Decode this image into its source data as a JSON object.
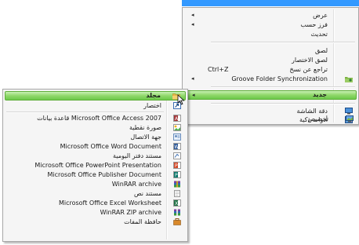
{
  "main_menu": {
    "items": [
      {
        "label": "عرض",
        "has_submenu": true
      },
      {
        "label": "فرز حسب",
        "has_submenu": true
      },
      {
        "label": "تحديث"
      },
      {
        "label": "لصق"
      },
      {
        "label": "لصق الاختصار"
      },
      {
        "label": "تراجع عن نسخ",
        "shortcut": "Ctrl+Z"
      },
      {
        "label": "Groove Folder Synchronization",
        "has_submenu": true,
        "icon": "groove-folder-icon"
      },
      {
        "label": "جديد",
        "has_submenu": true,
        "highlighted": true
      },
      {
        "label": "دقة الشاشة",
        "icon": "display-icon"
      },
      {
        "label": "أدوات ذكية",
        "icon": "gadgets-icon"
      },
      {
        "label": "تخصيص",
        "icon": "personalize-icon"
      }
    ],
    "arrow_glyph": "◂"
  },
  "new_submenu": {
    "items": [
      {
        "label": "مجلد",
        "icon": "folder-icon"
      },
      {
        "label": "اختصار",
        "icon": "shortcut-icon"
      },
      {
        "label": "Microsoft Office Access 2007 قاعدة بيانات",
        "icon": "access-icon"
      },
      {
        "label": "صورة نقطية",
        "icon": "bitmap-icon"
      },
      {
        "label": "جهة الاتصال",
        "icon": "contact-icon"
      },
      {
        "label": "Microsoft Office Word Document",
        "icon": "word-icon"
      },
      {
        "label": "مستند دفتر اليومية",
        "icon": "journal-icon"
      },
      {
        "label": "Microsoft Office PowerPoint Presentation",
        "icon": "powerpoint-icon"
      },
      {
        "label": "Microsoft Office Publisher Document",
        "icon": "publisher-icon"
      },
      {
        "label": "WinRAR archive",
        "icon": "winrar-icon"
      },
      {
        "label": "مستند نص",
        "icon": "text-document-icon"
      },
      {
        "label": "Microsoft Office Excel Worksheet",
        "icon": "excel-icon"
      },
      {
        "label": "WinRAR ZIP archive",
        "icon": "winrar-zip-icon"
      },
      {
        "label": "حافظة المفات",
        "icon": "briefcase-icon"
      }
    ]
  },
  "colors": {
    "highlight_top": "#c8f0b4",
    "highlight_bottom": "#6cc84a",
    "selection_bar": "#3399ff"
  }
}
